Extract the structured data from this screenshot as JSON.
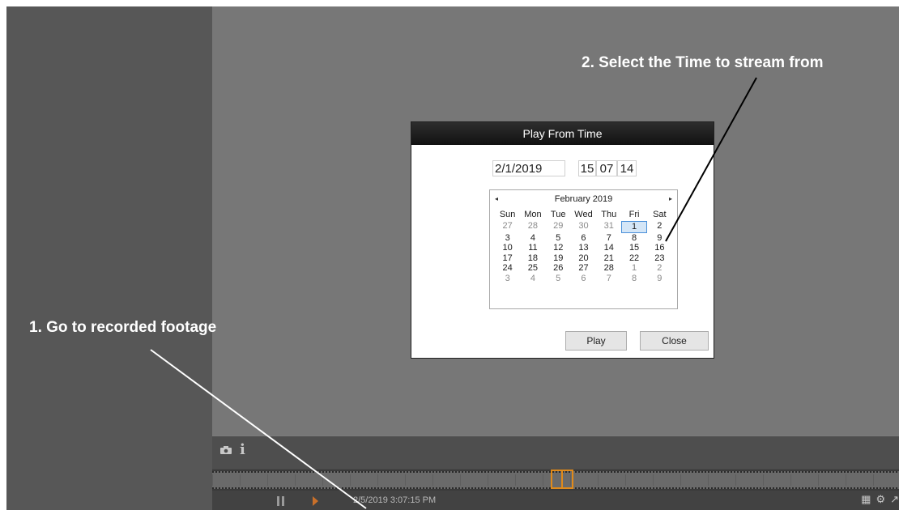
{
  "annotations": {
    "step1": "1. Go to recorded footage",
    "step2": "2. Select the Time to stream from"
  },
  "dialog": {
    "title": "Play From Time",
    "date_value": "2/1/2019",
    "time_hours": "15",
    "time_minutes": "07",
    "time_seconds": "14",
    "play_label": "Play",
    "close_label": "Close"
  },
  "calendar": {
    "month_label": "February 2019",
    "prev_icon": "◂",
    "next_icon": "▸",
    "weekdays": [
      "Sun",
      "Mon",
      "Tue",
      "Wed",
      "Thu",
      "Fri",
      "Sat"
    ],
    "weeks": [
      [
        "27",
        "28",
        "29",
        "30",
        "31",
        "1",
        "2"
      ],
      [
        "3",
        "4",
        "5",
        "6",
        "7",
        "8",
        "9"
      ],
      [
        "10",
        "11",
        "12",
        "13",
        "14",
        "15",
        "16"
      ],
      [
        "17",
        "18",
        "19",
        "20",
        "21",
        "22",
        "23"
      ],
      [
        "24",
        "25",
        "26",
        "27",
        "28",
        "1",
        "2"
      ],
      [
        "3",
        "4",
        "5",
        "6",
        "7",
        "8",
        "9"
      ]
    ],
    "muted": [
      [
        true,
        true,
        true,
        true,
        true,
        false,
        false
      ],
      [
        false,
        false,
        false,
        false,
        false,
        false,
        false
      ],
      [
        false,
        false,
        false,
        false,
        false,
        false,
        false
      ],
      [
        false,
        false,
        false,
        false,
        false,
        false,
        false
      ],
      [
        false,
        false,
        false,
        false,
        false,
        true,
        true
      ],
      [
        true,
        true,
        true,
        true,
        true,
        true,
        true
      ]
    ],
    "selected_day": "1"
  },
  "player": {
    "timestamp": "2/5/2019 3:07:15 PM",
    "info_icon": "i"
  },
  "colors": {
    "playhead": "#e08a1a",
    "annotation_text": "#ffffff"
  }
}
